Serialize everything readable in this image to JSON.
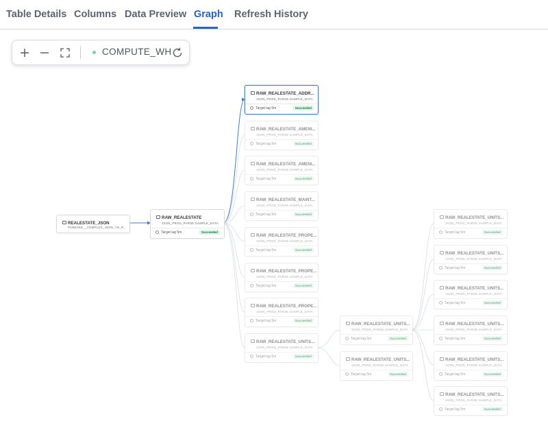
{
  "tabs": [
    {
      "label": "Table Details",
      "active": false
    },
    {
      "label": "Columns",
      "active": false
    },
    {
      "label": "Data Preview",
      "active": false
    },
    {
      "label": "Graph",
      "active": true
    },
    {
      "label": "Refresh History",
      "active": false
    }
  ],
  "toolbar": {
    "zoom_in_icon": "plus-icon",
    "zoom_out_icon": "minus-icon",
    "fit_icon": "fit-screen-icon",
    "refresh_icon": "refresh-icon",
    "warehouse_name": "COMPUTE_WH",
    "warehouse_status_color": "#7bd3a4"
  },
  "graph": {
    "accent_color": "#3a7bd5",
    "status_color": "#137a45",
    "source": {
      "name": "REALESTATE_JSON",
      "schema": "PANDAKE__COMPLEX_JSON_TO_R..."
    },
    "root": {
      "name": "RAW_REALESTATE",
      "schema": "JSON_PROD_PARSE.SAMPLE_DATA",
      "lag": "Target lag 5m",
      "status": "Succeeded"
    },
    "children": [
      {
        "name": "RAW_REALESTATE_ADDR...",
        "schema": "JSON_PROD_PARSE.SAMPLE_DATA",
        "lag": "Target lag 5m",
        "status": "Succeeded",
        "selected": true
      },
      {
        "name": "RAW_REALESTATE_AMENI...",
        "schema": "JSON_PROD_PARSE.SAMPLE_DATA",
        "lag": "Target lag 5m",
        "status": "Succeeded"
      },
      {
        "name": "RAW_REALESTATE_AMENI...",
        "schema": "JSON_PROD_PARSE.SAMPLE_DATA",
        "lag": "Target lag 5m",
        "status": "Succeeded"
      },
      {
        "name": "RAW_REALESTATE_MAINT...",
        "schema": "JSON_PROD_PARSE.SAMPLE_DATA",
        "lag": "Target lag 5m",
        "status": "Succeeded"
      },
      {
        "name": "RAW_REALESTATE_PROPE...",
        "schema": "JSON_PROD_PARSE.SAMPLE_DATA",
        "lag": "Target lag 5m",
        "status": "Succeeded"
      },
      {
        "name": "RAW_REALESTATE_PROPE...",
        "schema": "JSON_PROD_PARSE.SAMPLE_DATA",
        "lag": "Target lag 5m",
        "status": "Succeeded"
      },
      {
        "name": "RAW_REALESTATE_PROPE...",
        "schema": "JSON_PROD_PARSE.SAMPLE_DATA",
        "lag": "Target lag 5m",
        "status": "Succeeded"
      },
      {
        "name": "RAW_REALESTATE_UNITS...",
        "schema": "JSON_PROD_PARSE.SAMPLE_DATA",
        "lag": "Target lag 5m",
        "status": "Succeeded"
      }
    ],
    "grandchildren": [
      {
        "name": "RAW_REALESTATE_UNITS...",
        "schema": "JSON_PROD_PARSE.SAMPLE_DATA",
        "lag": "Target lag 5m",
        "status": "Succeeded"
      },
      {
        "name": "RAW_REALESTATE_UNITS...",
        "schema": "JSON_PROD_PARSE.SAMPLE_DATA",
        "lag": "Target lag 5m",
        "status": "Succeeded"
      }
    ],
    "leaves": [
      {
        "name": "RAW_REALESTATE_UNITS...",
        "schema": "JSON_PROD_PARSE.SAMPLE_DATA",
        "lag": "Target lag 5m",
        "status": "Succeeded"
      },
      {
        "name": "RAW_REALESTATE_UNITS...",
        "schema": "JSON_PROD_PARSE.SAMPLE_DATA",
        "lag": "Target lag 5m",
        "status": "Succeeded"
      },
      {
        "name": "RAW_REALESTATE_UNITS...",
        "schema": "JSON_PROD_PARSE.SAMPLE_DATA",
        "lag": "Target lag 5m",
        "status": "Succeeded"
      },
      {
        "name": "RAW_REALESTATE_UNITS...",
        "schema": "JSON_PROD_PARSE.SAMPLE_DATA",
        "lag": "Target lag 5m",
        "status": "Succeeded"
      },
      {
        "name": "RAW_REALESTATE_UNITS...",
        "schema": "JSON_PROD_PARSE.SAMPLE_DATA",
        "lag": "Target lag 5m",
        "status": "Succeeded"
      },
      {
        "name": "RAW_REALESTATE_UNITS...",
        "schema": "JSON_PROD_PARSE.SAMPLE_DATA",
        "lag": "Target lag 5m",
        "status": "Succeeded"
      }
    ]
  }
}
